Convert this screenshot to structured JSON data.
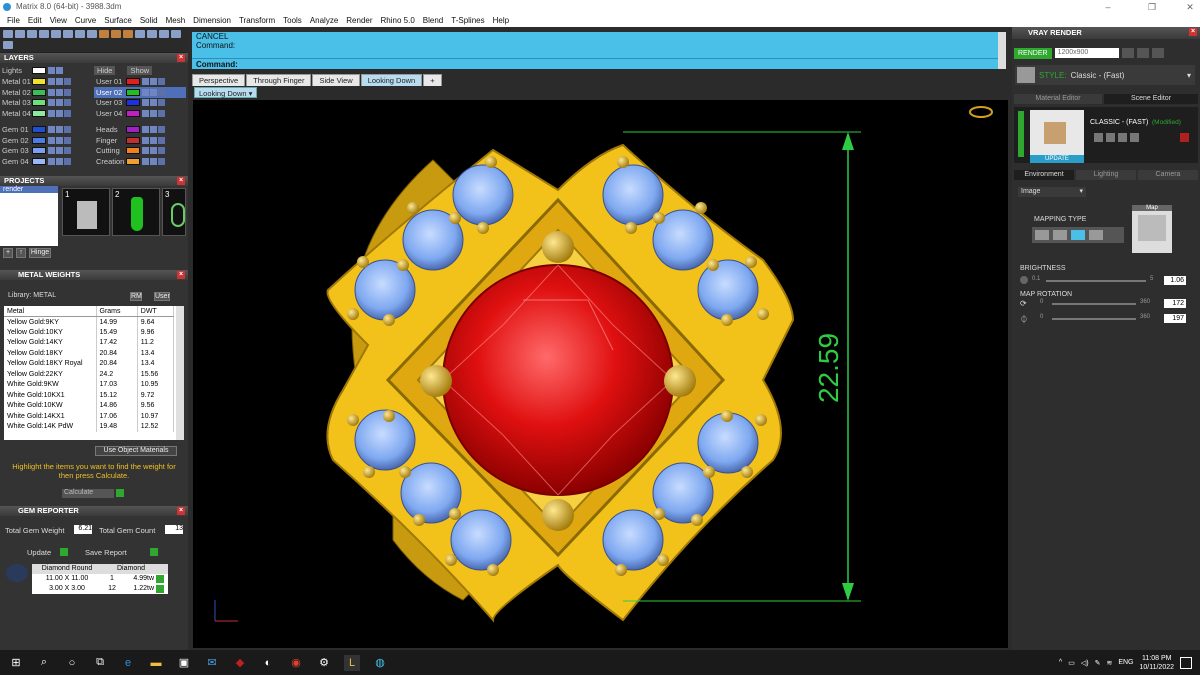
{
  "window": {
    "title": "Matrix 8.0 (64-bit) - 3988.3dm"
  },
  "menu": [
    "File",
    "Edit",
    "View",
    "Curve",
    "Surface",
    "Solid",
    "Mesh",
    "Dimension",
    "Transform",
    "Tools",
    "Analyze",
    "Render",
    "Rhino 5.0",
    "Blend",
    "T-Splines",
    "Help"
  ],
  "layers": {
    "title": "LAYERS",
    "hide": "Hide",
    "show": "Show",
    "lights": "Lights",
    "left": [
      {
        "name": "Metal 01",
        "color": "#f0e030"
      },
      {
        "name": "Metal 02",
        "color": "#3dbd5a"
      },
      {
        "name": "Metal 03",
        "color": "#6ee07a"
      },
      {
        "name": "Metal 04",
        "color": "#8fe8a0"
      },
      {
        "name": "Gem 01",
        "color": "#2050d0"
      },
      {
        "name": "Gem 02",
        "color": "#4a7de8"
      },
      {
        "name": "Gem 03",
        "color": "#7aa0f0"
      },
      {
        "name": "Gem 04",
        "color": "#9ab8f8"
      }
    ],
    "right": [
      {
        "name": "User 01",
        "color": "#e02020"
      },
      {
        "name": "User 02",
        "color": "#20c020"
      },
      {
        "name": "User 03",
        "color": "#2030e0"
      },
      {
        "name": "User 04",
        "color": "#c020c0"
      },
      {
        "name": "Heads",
        "color": "#a020c0"
      },
      {
        "name": "Finger",
        "color": "#c03030"
      },
      {
        "name": "Cutting",
        "color": "#f08020"
      },
      {
        "name": "Creation",
        "color": "#f0a030"
      }
    ]
  },
  "projects": {
    "title": "PROJECTS",
    "item": "render",
    "thumbs": [
      "1",
      "2",
      "3"
    ],
    "hinge": "Hinge"
  },
  "metal_weights": {
    "title": "METAL WEIGHTS",
    "library_label": "Library: METAL",
    "rm": "RM",
    "user": "User",
    "headers": [
      "Metal",
      "Grams",
      "DWT"
    ],
    "rows": [
      [
        "Yellow Gold:9KY",
        "14.99",
        "9.64"
      ],
      [
        "Yellow Gold:10KY",
        "15.49",
        "9.96"
      ],
      [
        "Yellow Gold:14KY",
        "17.42",
        "11.2"
      ],
      [
        "Yellow Gold:18KY",
        "20.84",
        "13.4"
      ],
      [
        "Yellow Gold:18KY Royal",
        "20.84",
        "13.4"
      ],
      [
        "Yellow Gold:22KY",
        "24.2",
        "15.56"
      ],
      [
        "White Gold:9KW",
        "17.03",
        "10.95"
      ],
      [
        "White Gold:10KX1",
        "15.12",
        "9.72"
      ],
      [
        "White Gold:10KW",
        "14.86",
        "9.56"
      ],
      [
        "White Gold:14KX1",
        "17.06",
        "10.97"
      ],
      [
        "White Gold:14K PdW",
        "19.48",
        "12.52"
      ]
    ],
    "use_object": "Use Object Materials",
    "hint": "Highlight the items you want to find the weight for then press Calculate.",
    "calculate": "Calculate"
  },
  "gem_reporter": {
    "title": "GEM REPORTER",
    "total_weight_label": "Total Gem Weight",
    "total_weight": "6.21",
    "total_count_label": "Total Gem Count",
    "total_count": "13",
    "update": "Update",
    "save": "Save Report",
    "headers": [
      "Diamond Round",
      "Diamond"
    ],
    "rows": [
      [
        "11.00 X 11.00",
        "1",
        "4.99tw"
      ],
      [
        "3.00 X 3.00",
        "12",
        "1.22tw"
      ]
    ]
  },
  "command": {
    "line1": "CANCEL",
    "line2": "Command:",
    "prompt": "Command:"
  },
  "viewport": {
    "tabs": [
      "Perspective",
      "Through Finger",
      "Side View",
      "Looking Down"
    ],
    "active_tab": "Looking Down",
    "label": "Looking Down",
    "dimension": "22.59"
  },
  "vray": {
    "title": "VRAY RENDER",
    "render": "RENDER",
    "resolution": "1200x900",
    "style_label": "STYLE:",
    "style": "Classic - (Fast)",
    "tabs": [
      "Material Editor",
      "Scene Editor"
    ],
    "material_name": "CLASSIC - (FAST)",
    "modified": "(Modified)",
    "update": "UPDATE",
    "env_tabs": [
      "Environment",
      "Lighting",
      "Camera"
    ],
    "image_select": "Image",
    "mapping_type": "MAPPING TYPE",
    "map": "Map",
    "brightness": "BRIGHTNESS",
    "brightness_min": "0.1",
    "brightness_max": "5",
    "brightness_val": "1.06",
    "map_rotation": "MAP ROTATION",
    "rot1_min": "0",
    "rot1_max": "360",
    "rot1_val": "172",
    "rot2_min": "0",
    "rot2_max": "360",
    "rot2_val": "197"
  },
  "taskbar": {
    "time": "11:08 PM",
    "date": "10/11/2022",
    "lang": "ENG"
  },
  "colors": {
    "gold": "#f2c21a",
    "ruby": "#e01010",
    "sapphire": "#7ea8f0",
    "dimension": "#2ecc40",
    "accent": "#4ac0e8"
  }
}
